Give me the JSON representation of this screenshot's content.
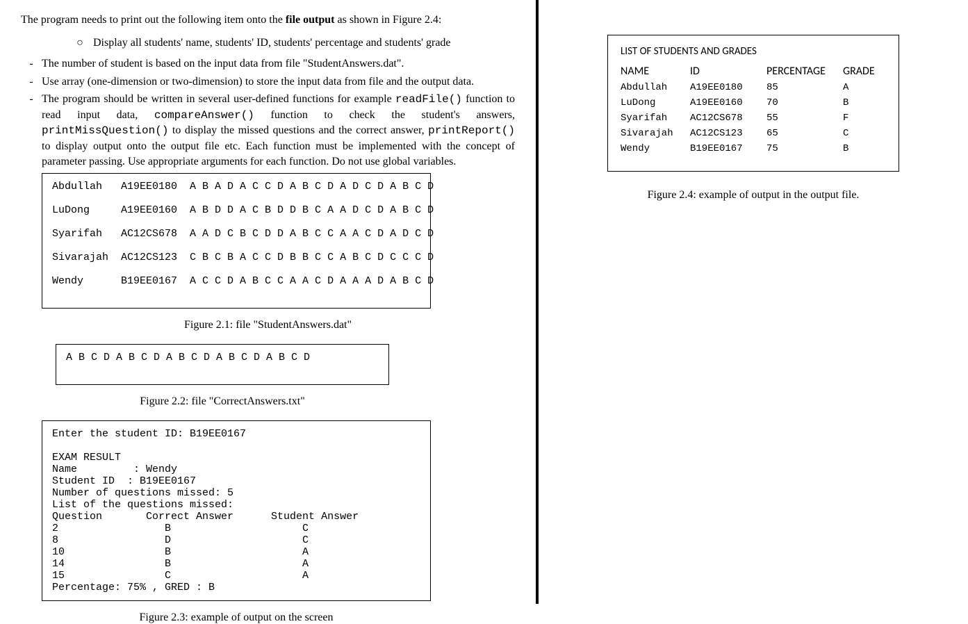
{
  "intro": {
    "prefix": "The program needs to print out the following item onto the ",
    "bold": "file output",
    "suffix": " as shown in Figure 2.4:"
  },
  "display_line": "Display all students' name, students' ID, students' percentage and students' grade",
  "bullets": {
    "b1": "The number of student is based on the input data from file \"StudentAnswers.dat\".",
    "b2": "Use array (one-dimension or two-dimension) to store the input data from file and the output data.",
    "b3_part1": "The program should be written in several user-defined functions for example ",
    "b3_fn1": "readFile()",
    "b3_part2": " function to read input data, ",
    "b3_fn2": "compareAnswer()",
    "b3_part3": " function to check the student's answers, ",
    "b3_fn3": "printMissQuestion()",
    "b3_part4": " to display the missed questions and the correct answer, ",
    "b3_fn4": "printReport()",
    "b3_part5": " to display output onto the output file etc. Each function must be implemented with the concept of parameter passing. Use appropriate arguments for each function. Do not use global variables."
  },
  "fig21": {
    "caption": "Figure 2.1: file \"StudentAnswers.dat\"",
    "rows": [
      {
        "name": "Abdullah",
        "id": "A19EE0180",
        "ans": "A B A D A C C D A B C D A D C D A B C D"
      },
      {
        "name": "LuDong",
        "id": "A19EE0160",
        "ans": "A B D D A C B D D B C A A D C D A B C D"
      },
      {
        "name": "Syarifah",
        "id": "AC12CS678",
        "ans": "A A D C B C D D A B C C A A C D A D C D"
      },
      {
        "name": "Sivarajah",
        "id": "AC12CS123",
        "ans": "C B C B A C C D B B C C A B C D C C C D"
      },
      {
        "name": "Wendy",
        "id": "B19EE0167",
        "ans": "A C C D A B C C A A C D A A A D A B C D"
      }
    ]
  },
  "fig22": {
    "caption": "Figure 2.2: file \"CorrectAnswers.txt\"",
    "content": "A B C D A B C D A B C D A B C D A B C D"
  },
  "fig23": {
    "caption": "Figure 2.3: example of output on the screen",
    "l1": "Enter the student ID: B19EE0167",
    "l2": "EXAM RESULT",
    "l3": "Name         : Wendy",
    "l4": "Student ID  : B19EE0167",
    "l5": "Number of questions missed: 5",
    "l6": "List of the questions missed:",
    "l7": "Question       Correct Answer      Student Answer",
    "rows": [
      {
        "q": "2",
        "c": "B",
        "s": "C"
      },
      {
        "q": "8",
        "c": "D",
        "s": "C"
      },
      {
        "q": "10",
        "c": "B",
        "s": "A"
      },
      {
        "q": "14",
        "c": "B",
        "s": "A"
      },
      {
        "q": "15",
        "c": "C",
        "s": "A"
      }
    ],
    "footer": "Percentage: 75% , GRED : B"
  },
  "fig24": {
    "caption": "Figure 2.4: example of output in the output file.",
    "title": "LIST OF STUDENTS AND GRADES",
    "header": {
      "c1": "NAME",
      "c2": "ID",
      "c3": "PERCENTAGE",
      "c4": "GRADE"
    },
    "rows": [
      {
        "name": "Abdullah",
        "id": "A19EE0180",
        "pct": "85",
        "grade": "A"
      },
      {
        "name": "LuDong",
        "id": "A19EE0160",
        "pct": "70",
        "grade": "B"
      },
      {
        "name": "Syarifah",
        "id": "AC12CS678",
        "pct": "55",
        "grade": "F"
      },
      {
        "name": "Sivarajah",
        "id": "AC12CS123",
        "pct": "65",
        "grade": "C"
      },
      {
        "name": "Wendy",
        "id": "B19EE0167",
        "pct": "75",
        "grade": "B"
      }
    ]
  }
}
